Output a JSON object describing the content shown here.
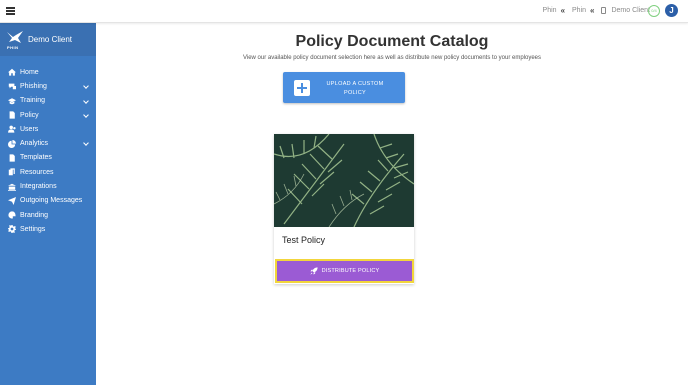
{
  "topbar": {
    "breadcrumbs": [
      {
        "label": "Phin"
      },
      {
        "label": "Phin"
      },
      {
        "label": "Demo Client"
      }
    ],
    "status_text": "0/4",
    "user_initial": "J"
  },
  "sidebar": {
    "brand_name": "Demo Client",
    "logo_text": "PHIN",
    "items": [
      {
        "label": "Home",
        "icon": "home-icon",
        "expandable": false
      },
      {
        "label": "Phishing",
        "icon": "phishing-icon",
        "expandable": true
      },
      {
        "label": "Training",
        "icon": "training-icon",
        "expandable": true
      },
      {
        "label": "Policy",
        "icon": "policy-icon",
        "expandable": true
      },
      {
        "label": "Users",
        "icon": "users-icon",
        "expandable": false
      },
      {
        "label": "Analytics",
        "icon": "analytics-icon",
        "expandable": true
      },
      {
        "label": "Templates",
        "icon": "templates-icon",
        "expandable": false
      },
      {
        "label": "Resources",
        "icon": "resources-icon",
        "expandable": false
      },
      {
        "label": "Integrations",
        "icon": "integrations-icon",
        "expandable": false
      },
      {
        "label": "Outgoing Messages",
        "icon": "outgoing-messages-icon",
        "expandable": false
      },
      {
        "label": "Branding",
        "icon": "branding-icon",
        "expandable": false
      },
      {
        "label": "Settings",
        "icon": "settings-icon",
        "expandable": false
      }
    ]
  },
  "main": {
    "title": "Policy Document Catalog",
    "subtitle": "View our available policy document selection here as well as distribute new policy documents to your employees",
    "upload_button": "UPLOAD A CUSTOM POLICY",
    "card": {
      "title": "Test Policy",
      "action": "DISTRIBUTE POLICY"
    }
  },
  "colors": {
    "sidebar": "#3d7bc4",
    "primary_button": "#4a8ee0",
    "distribute_button": "#9b5bd4",
    "highlight_border": "#f2d63c"
  }
}
